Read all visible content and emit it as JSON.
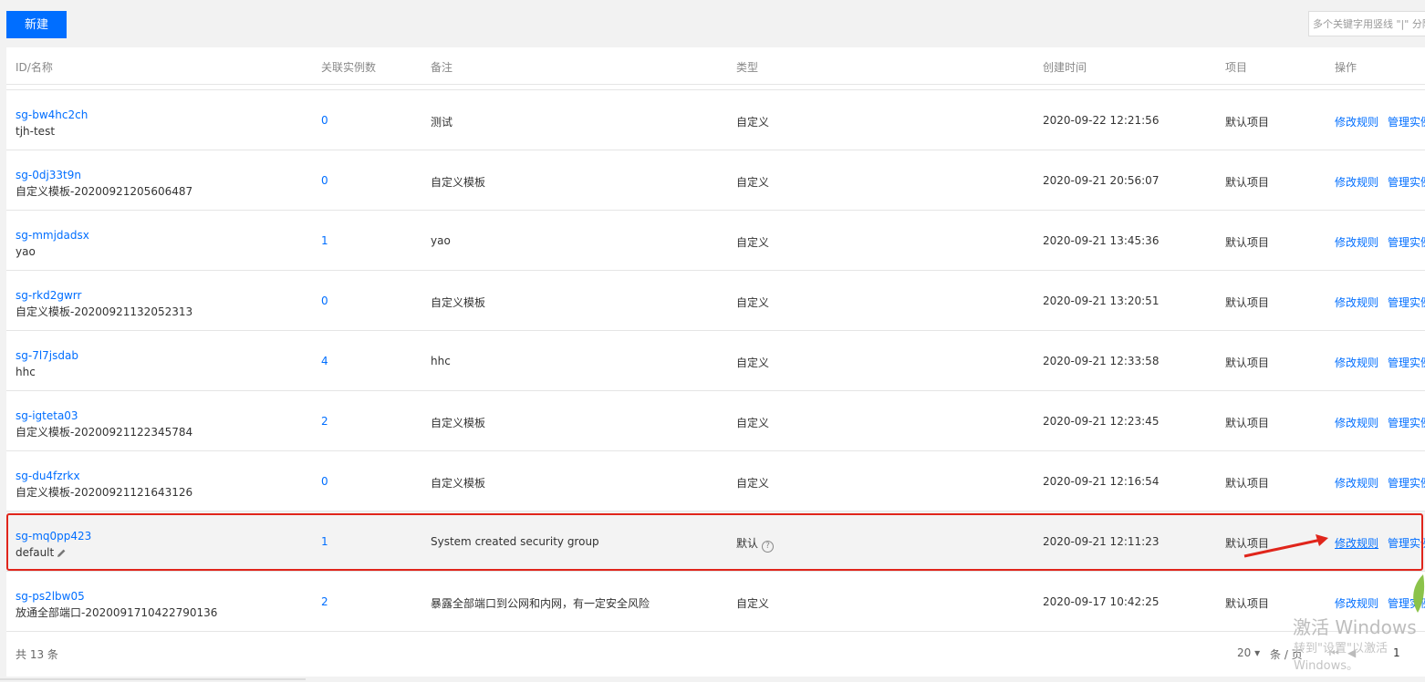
{
  "toolbar": {
    "new_label": "新建",
    "search_placeholder": "多个关键字用竖线 \"|\" 分隔"
  },
  "table": {
    "headers": {
      "id_name": "ID/名称",
      "count": "关联实例数",
      "note": "备注",
      "type": "类型",
      "created": "创建时间",
      "project": "项目",
      "actions": "操作"
    },
    "rows": [
      {
        "id": "sg-bw4hc2ch",
        "name": "tjh-test",
        "count": "0",
        "note": "测试",
        "type": "自定义",
        "created": "2020-09-22 12:21:56",
        "project": "默认项目",
        "act1": "修改规则",
        "act2": "管理实例"
      },
      {
        "id": "sg-0dj33t9n",
        "name": "自定义模板-20200921205606487",
        "count": "0",
        "note": "自定义模板",
        "type": "自定义",
        "created": "2020-09-21 20:56:07",
        "project": "默认项目",
        "act1": "修改规则",
        "act2": "管理实例"
      },
      {
        "id": "sg-mmjdadsx",
        "name": "yao",
        "count": "1",
        "note": "yao",
        "type": "自定义",
        "created": "2020-09-21 13:45:36",
        "project": "默认项目",
        "act1": "修改规则",
        "act2": "管理实例"
      },
      {
        "id": "sg-rkd2gwrr",
        "name": "自定义模板-20200921132052313",
        "count": "0",
        "note": "自定义模板",
        "type": "自定义",
        "created": "2020-09-21 13:20:51",
        "project": "默认项目",
        "act1": "修改规则",
        "act2": "管理实例"
      },
      {
        "id": "sg-7l7jsdab",
        "name": "hhc",
        "count": "4",
        "note": "hhc",
        "type": "自定义",
        "created": "2020-09-21 12:33:58",
        "project": "默认项目",
        "act1": "修改规则",
        "act2": "管理实例"
      },
      {
        "id": "sg-igteta03",
        "name": "自定义模板-20200921122345784",
        "count": "2",
        "note": "自定义模板",
        "type": "自定义",
        "created": "2020-09-21 12:23:45",
        "project": "默认项目",
        "act1": "修改规则",
        "act2": "管理实例"
      },
      {
        "id": "sg-du4fzrkx",
        "name": "自定义模板-20200921121643126",
        "count": "0",
        "note": "自定义模板",
        "type": "自定义",
        "created": "2020-09-21 12:16:54",
        "project": "默认项目",
        "act1": "修改规则",
        "act2": "管理实例"
      },
      {
        "id": "sg-mq0pp423",
        "name": "default",
        "count": "1",
        "note": "System created security group",
        "type": "默认",
        "created": "2020-09-21 12:11:23",
        "project": "默认项目",
        "act1": "修改规则",
        "act2": "管理实例"
      },
      {
        "id": "sg-ps2lbw05",
        "name": "放通全部端口-2020091710422790136",
        "count": "2",
        "note": "暴露全部端口到公网和内网，有一定安全风险",
        "type": "自定义",
        "created": "2020-09-17 10:42:25",
        "project": "默认项目",
        "act1": "修改规则",
        "act2": "管理实例"
      }
    ]
  },
  "pagination": {
    "total": "共  13  条",
    "page_size": "20",
    "per_page_label": "条 / 页",
    "page_number": "1"
  },
  "watermark": {
    "line1": "激活 Windows",
    "line2": "转到\"设置\"以激活 Windows。"
  },
  "colors": {
    "accent": "#006eff",
    "highlight_box": "#e0251b"
  }
}
